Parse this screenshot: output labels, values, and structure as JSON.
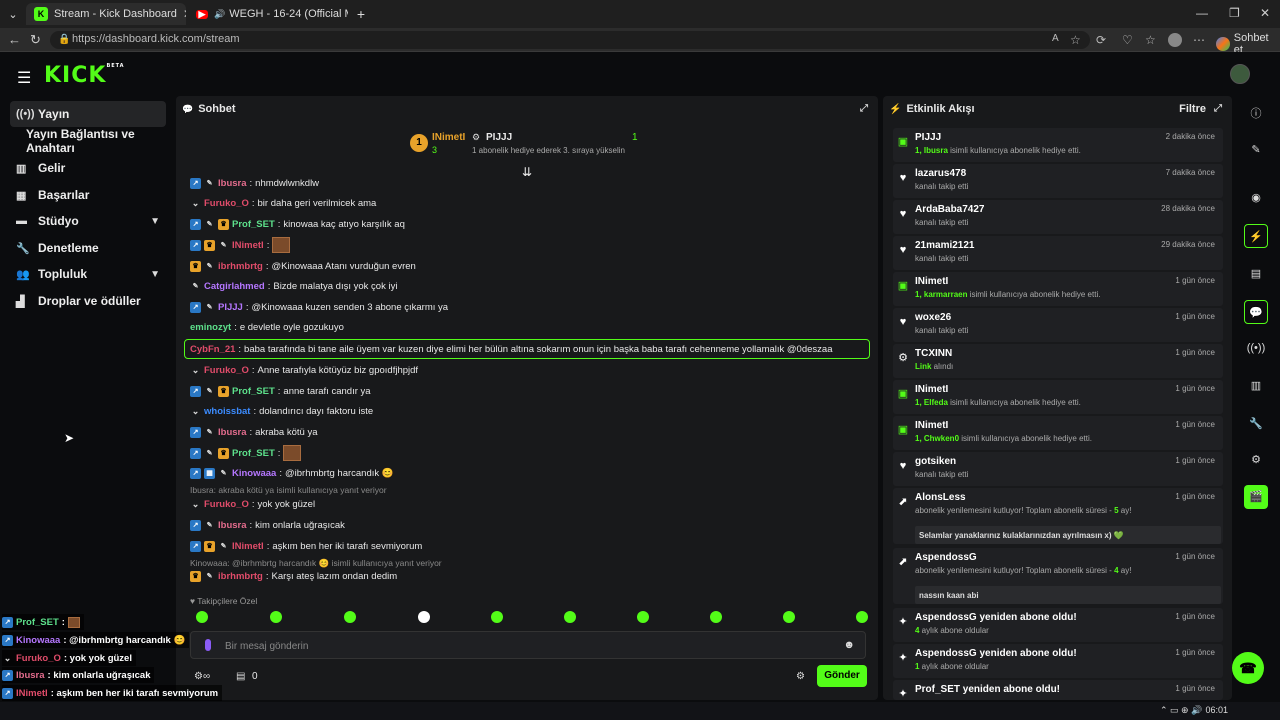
{
  "browser": {
    "tabs": [
      {
        "title": "Stream - Kick Dashboard",
        "active": true
      },
      {
        "title": "WEGH - 16-24 (Official Music",
        "active": false
      }
    ],
    "url": "https://dashboard.kick.com/stream",
    "copilot_label": "Sohbet et",
    "new_tab": "+"
  },
  "topnav": {
    "logo": "KICK",
    "logo_badge": "BETA"
  },
  "sidebar": {
    "items": [
      {
        "label": "Yayın",
        "icon": "broadcast-icon",
        "selected": true
      },
      {
        "label": "Yayın Bağlantısı ve Anahtarı",
        "icon": ""
      },
      {
        "label": "Gelir",
        "icon": "revenue-icon"
      },
      {
        "label": "Başarılar",
        "icon": "trophy-icon"
      },
      {
        "label": "Stüdyo",
        "icon": "studio-icon",
        "expandable": true
      },
      {
        "label": "Denetleme",
        "icon": "wrench-icon"
      },
      {
        "label": "Topluluk",
        "icon": "community-icon",
        "expandable": true
      },
      {
        "label": "Droplar ve ödüller",
        "icon": "gift-icon"
      }
    ]
  },
  "chat": {
    "title": "Sohbet",
    "pinned": {
      "rank": "1",
      "top_user": "INimetI",
      "top_count": "3",
      "gifter": "PIJJJ",
      "gifter_count": "1",
      "note": "1 abonelik hediye ederek 3. sıraya yükselin"
    },
    "messages": [
      {
        "user": "Ibusra",
        "color": "#e36c8d",
        "text": "nhmdwlwnkdlw",
        "badges": [
          "vip",
          "pen"
        ]
      },
      {
        "user": "Furuko_O",
        "color": "#e04c6a",
        "text": "bir daha geri verilmicek ama",
        "badges": [
          "chev"
        ]
      },
      {
        "user": "Prof_SET",
        "color": "#5de08b",
        "text": "kinowaa kaç atıyo karşılık aq",
        "badges": [
          "vip",
          "pen",
          "crown"
        ]
      },
      {
        "user": "INimetI",
        "color": "#e04c6a",
        "text": "",
        "badges": [
          "vip",
          "crown",
          "pen"
        ],
        "emote": true
      },
      {
        "user": "ibrhmbrtg",
        "color": "#e04c6a",
        "text": "@Kinowaaa Atanı vurduğun evren",
        "badges": [
          "crown",
          "pen"
        ]
      },
      {
        "user": "Catgirlahmed",
        "color": "#b577ff",
        "text": "Bizde malatya dışı yok çok iyi",
        "badges": [
          "pen"
        ]
      },
      {
        "user": "PIJJJ",
        "color": "#b577ff",
        "text": "@Kinowaaa kuzen senden 3 abone çıkarmı ya",
        "badges": [
          "vip",
          "pen"
        ]
      },
      {
        "user": "eminozyt",
        "color": "#5de08b",
        "text": "e devletle oyle gozukuyo",
        "badges": []
      },
      {
        "user": "CybFn_21",
        "color": "#e04c6a",
        "text": "baba tarafında bi tane aile üyem var kuzen diye elimi her bülün altına sokarım onun için başka baba tarafı cehenneme yollamalık @0deszaa",
        "badges": []
      },
      {
        "user": "Furuko_O",
        "color": "#e04c6a",
        "text": "Anne tarafıyla kötüyüz biz gpoıdfjhpjdf",
        "badges": [
          "chev"
        ]
      },
      {
        "user": "Prof_SET",
        "color": "#5de08b",
        "text": "anne tarafı candır ya",
        "badges": [
          "vip",
          "pen",
          "crown"
        ]
      },
      {
        "user": "whoissbat",
        "color": "#3c8cff",
        "text": "dolandırıcı dayı faktoru iste",
        "badges": [
          "chev"
        ]
      },
      {
        "user": "Ibusra",
        "color": "#e36c8d",
        "text": "akraba kötü ya",
        "badges": [
          "vip",
          "pen"
        ]
      },
      {
        "user": "Prof_SET",
        "color": "#5de08b",
        "text": "",
        "badges": [
          "vip",
          "pen",
          "crown"
        ],
        "emote": true
      },
      {
        "user": "Kinowaaa",
        "color": "#b577ff",
        "text": "@ibrhmbrtg harcandık 😊",
        "badges": [
          "vip",
          "sub",
          "pen"
        ]
      },
      {
        "user": "Furuko_O",
        "color": "#e04c6a",
        "text": "yok yok güzel",
        "badges": [
          "chev"
        ],
        "reply": "Ibusra: akraba kötü ya isimli kullanıcıya yanıt veriyor"
      },
      {
        "user": "Ibusra",
        "color": "#e36c8d",
        "text": "kim onlarla uğraşıcak",
        "badges": [
          "vip",
          "pen"
        ]
      },
      {
        "user": "INimetI",
        "color": "#e04c6a",
        "text": "aşkım ben her iki tarafı sevmiyorum",
        "badges": [
          "vip",
          "crown",
          "pen"
        ]
      },
      {
        "user": "ibrhmbrtg",
        "color": "#e04c6a",
        "text": "Karşı ateş lazım ondan dedim",
        "badges": [
          "crown",
          "pen"
        ],
        "reply": "Kinowaaa: @ibrhmbrtg harcandık 😊 isimli kullanıcıya yanıt veriyor"
      }
    ],
    "followers_only": "Takipçilere Özel",
    "input_placeholder": "Bir mesaj gönderin",
    "footer_count1": "0",
    "footer_count2": "0",
    "send_label": "Gönder"
  },
  "activity": {
    "title": "Etkinlik Akışı",
    "filter_label": "Filtre",
    "items": [
      {
        "name": "PIJJJ",
        "time": "2 dakika önce",
        "type": "gift",
        "desc_prefix": "1, Ibusra",
        "desc": " isimli kullanıcıya abonelik hediye etti."
      },
      {
        "name": "lazarus478",
        "time": "7 dakika önce",
        "type": "follow",
        "desc": "kanalı takip etti"
      },
      {
        "name": "ArdaBaba7427",
        "time": "28 dakika önce",
        "type": "follow",
        "desc": "kanalı takip etti"
      },
      {
        "name": "21mami2121",
        "time": "29 dakika önce",
        "type": "follow",
        "desc": "kanalı takip etti"
      },
      {
        "name": "INimetI",
        "time": "1 gün önce",
        "type": "gift",
        "desc_prefix": "1, karmarraen",
        "desc": " isimli kullanıcıya abonelik hediye etti."
      },
      {
        "name": "woxe26",
        "time": "1 gün önce",
        "type": "follow",
        "desc": "kanalı takip etti"
      },
      {
        "name": "TCXINN",
        "time": "1 gün önce",
        "type": "link",
        "desc_prefix": "Link",
        "desc": " alındı"
      },
      {
        "name": "INimetI",
        "time": "1 gün önce",
        "type": "gift",
        "desc_prefix": "1, Elfeda",
        "desc": " isimli kullanıcıya abonelik hediye etti."
      },
      {
        "name": "INimetI",
        "time": "1 gün önce",
        "type": "gift",
        "desc_prefix": "1, Chwken0",
        "desc": " isimli kullanıcıya abonelik hediye etti."
      },
      {
        "name": "gotsiken",
        "time": "1 gün önce",
        "type": "follow",
        "desc": "kanalı takip etti"
      },
      {
        "name": "AlonsLess",
        "time": "1 gün önce",
        "type": "resub",
        "desc": "abonelik yenilemesini kutluyor! Toplam abonelik süresi - ",
        "months": "5",
        "unit": " ay!",
        "message": "Selamlar yanaklarınız kulaklarınızdan ayrılmasın x) 💚"
      },
      {
        "name": "AspendossG",
        "time": "1 gün önce",
        "type": "resub",
        "desc": "abonelik yenilemesini kutluyor! Toplam abonelik süresi - ",
        "months": "4",
        "unit": " ay!",
        "message": "nassın kaan abi"
      },
      {
        "name": "AspendossG yeniden abone oldu!",
        "time": "1 gün önce",
        "type": "sub",
        "desc_prefix": "4",
        "desc": " aylık abone oldular"
      },
      {
        "name": "AspendossG yeniden abone oldu!",
        "time": "1 gün önce",
        "type": "sub",
        "desc_prefix": "1",
        "desc": " aylık abone oldular"
      },
      {
        "name": "Prof_SET yeniden abone oldu!",
        "time": "1 gün önce",
        "type": "sub",
        "desc_prefix": "",
        "desc": ""
      }
    ]
  },
  "overlay": {
    "lines": [
      {
        "user": "Prof_SET",
        "color": "#5de08b",
        "text": ":",
        "emote": true
      },
      {
        "user": "Kinowaaa",
        "color": "#b577ff",
        "text": ": @ibrhmbrtg harcandık 😊"
      },
      {
        "user": "Furuko_O",
        "color": "#e04c6a",
        "text": ": yok yok güzel"
      },
      {
        "user": "Ibusra",
        "color": "#e36c8d",
        "text": ": kim onlarla uğraşıcak"
      },
      {
        "user": "INimetI",
        "color": "#e04c6a",
        "text": ": aşkım ben her iki tarafı sevmiyorum"
      },
      {
        "user": "ibrhmbrtg",
        "color": "#e04c6a",
        "text": ": Karşı ateş lazım ondan dedim"
      }
    ]
  },
  "taskbar": {
    "clock": "06:01"
  },
  "colors": {
    "accent": "#53fc18",
    "bg": "#0b0c0e",
    "panel": "#18191b"
  }
}
